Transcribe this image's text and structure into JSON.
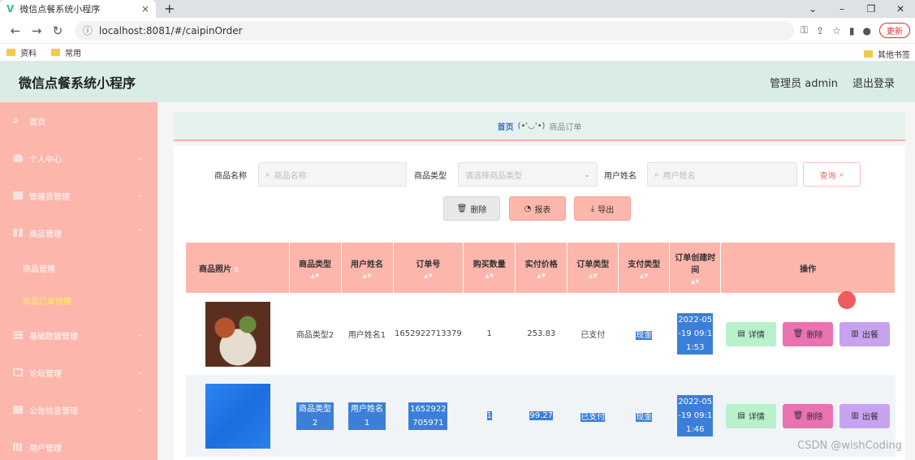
{
  "browser": {
    "tab_title": "微信点餐系统小程序",
    "tab_close": "×",
    "new_tab": "+",
    "url": "localhost:8081/#/caipinOrder",
    "update_label": "更新",
    "bookmarks": [
      "资料",
      "常用"
    ],
    "bookmarks_right": "其他书签"
  },
  "header": {
    "title": "微信点餐系统小程序",
    "user": "管理员 admin",
    "logout": "退出登录"
  },
  "sidebar": {
    "items": [
      {
        "label": "首页",
        "icon": "home-icon"
      },
      {
        "label": "个人中心",
        "icon": "user-icon",
        "chevron": "⌄"
      },
      {
        "label": "管理员管理",
        "icon": "admin-icon",
        "chevron": "⌄"
      },
      {
        "label": "商品管理",
        "icon": "grid-icon",
        "chevron": "⌃"
      },
      {
        "label": "基础数据管理",
        "icon": "table-icon",
        "chevron": "⌄"
      },
      {
        "label": "论坛管理",
        "icon": "forum-icon",
        "chevron": "⌄"
      },
      {
        "label": "公告信息管理",
        "icon": "notice-icon",
        "chevron": "⌄"
      },
      {
        "label": "用户管理",
        "icon": "users-icon"
      }
    ],
    "sub_items": [
      {
        "label": "商品管理",
        "active": false
      },
      {
        "label": "商品订单管理",
        "active": true
      }
    ]
  },
  "breadcrumb": {
    "home": "首页",
    "face": "(•'◡'•)",
    "current": "商品订单"
  },
  "search": {
    "name_label": "商品名称",
    "name_placeholder": "商品名称",
    "type_label": "商品类型",
    "type_placeholder": "请选择商品类型",
    "user_label": "用户姓名",
    "user_placeholder": "用户姓名",
    "query_button": "查询"
  },
  "actions": {
    "delete": "删除",
    "report": "报表",
    "export": "导出"
  },
  "table": {
    "headers": [
      "商品照片",
      "商品类型",
      "用户姓名",
      "订单号",
      "购买数量",
      "实付价格",
      "订单类型",
      "支付类型",
      "订单创建时间",
      "操作"
    ],
    "rows": [
      {
        "type": "商品类型2",
        "user": "用户姓名1",
        "order_no": "1652922713379",
        "qty": "1",
        "price": "253.83",
        "order_type": "已支付",
        "pay_type": "现金",
        "created": "2022-05-19 09:11:53"
      },
      {
        "type": "商品类型2",
        "user": "用户姓名1",
        "order_no": "1652922705971",
        "qty": "1",
        "price": "99.27",
        "order_type": "已支付",
        "pay_type": "现金",
        "created": "2022-05-19 09:11:46"
      }
    ],
    "op_detail": "详情",
    "op_delete": "删除",
    "op_serve": "出餐"
  },
  "watermark": "CSDN @wishCoding",
  "colors": {
    "sidebar": "#fdb6ab",
    "header": "#d9ece5",
    "accent_active": "#fff35a",
    "selection": "#3b7fd8"
  }
}
